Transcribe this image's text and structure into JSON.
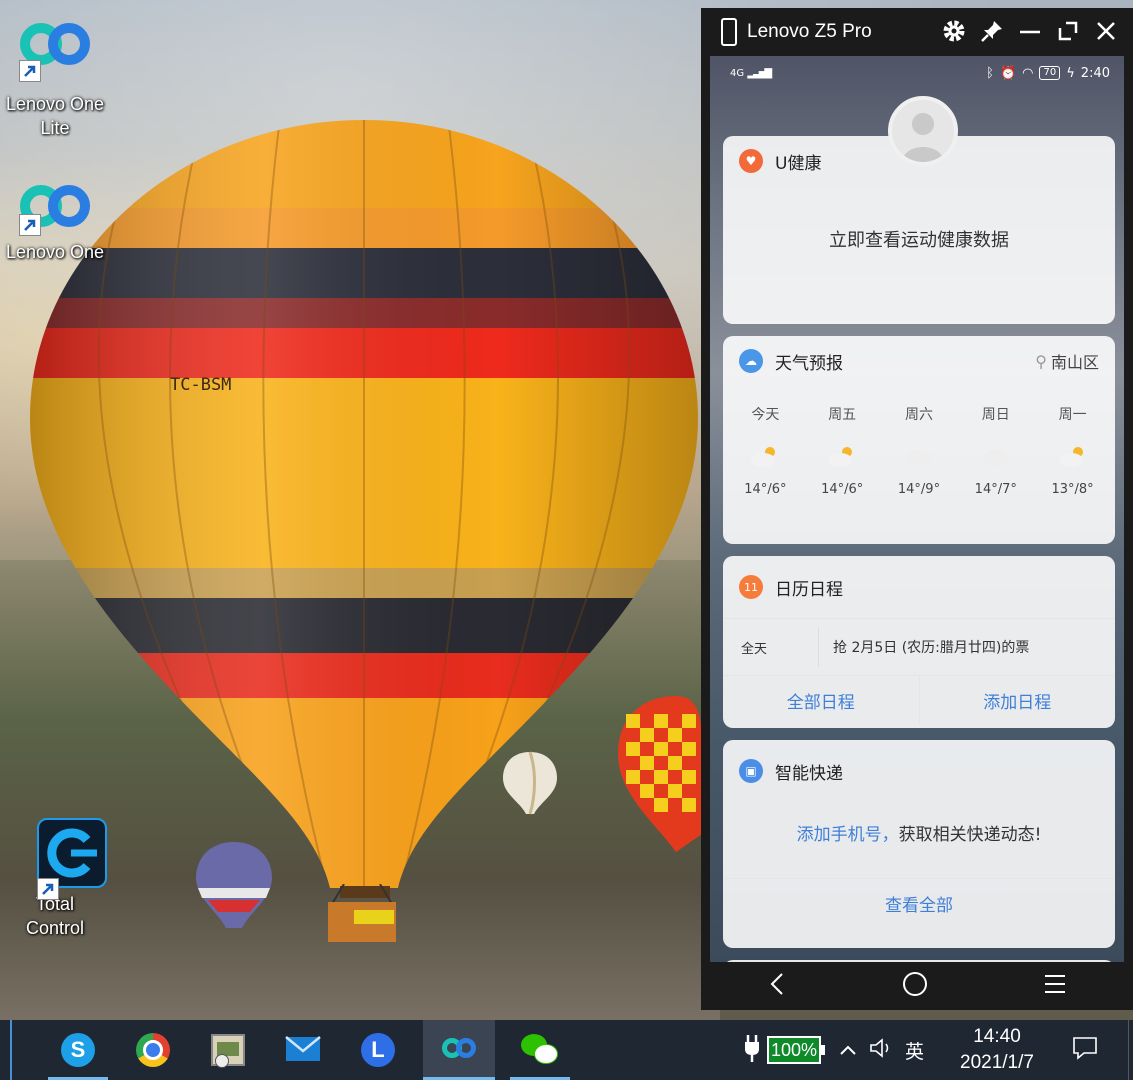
{
  "desktop": {
    "icons": [
      {
        "label": "Lenovo One Lite",
        "icon": "lenovo-one-lite-icon"
      },
      {
        "label": "Lenovo One",
        "icon": "lenovo-one-icon"
      },
      {
        "label": "Total Control",
        "icon": "total-control-icon"
      }
    ],
    "balloon_marking": "TC-BSM"
  },
  "phone_window": {
    "title": "Lenovo Z5 Pro",
    "buttons": [
      "gear-icon",
      "pin-icon",
      "minimize-icon",
      "maximize-icon",
      "close-icon"
    ],
    "status_bar": {
      "signal": "4G",
      "battery": "70",
      "time": "2:40"
    },
    "health_card": {
      "title": "U健康",
      "message": "立即查看运动健康数据"
    },
    "weather_card": {
      "title": "天气预报",
      "location": "南山区",
      "days": [
        {
          "day": "今天",
          "temp": "14°/6°",
          "icon": "sunny-cloud-icon"
        },
        {
          "day": "周五",
          "temp": "14°/6°",
          "icon": "sunny-cloud-icon"
        },
        {
          "day": "周六",
          "temp": "14°/9°",
          "icon": "cloud-icon"
        },
        {
          "day": "周日",
          "temp": "14°/7°",
          "icon": "cloud-icon"
        },
        {
          "day": "周一",
          "temp": "13°/8°",
          "icon": "sunny-cloud-icon"
        }
      ]
    },
    "calendar_card": {
      "badge": "11",
      "title": "日历日程",
      "event_time": "全天",
      "event_text": "抢 2月5日 (农历:腊月廿四)的票",
      "all_link": "全部日程",
      "add_link": "添加日程"
    },
    "delivery_card": {
      "title": "智能快递",
      "message_link": "添加手机号，",
      "message_rest": "获取相关快递动态!",
      "view_all": "查看全部"
    }
  },
  "taskbar": {
    "apps": [
      "skype-icon",
      "chrome-icon",
      "photo-viewer-icon",
      "mail-icon",
      "lenovo-l-icon",
      "lenovo-one-icon",
      "wechat-icon"
    ],
    "battery_percent": "100%",
    "ime": "英",
    "time": "14:40",
    "date": "2021/1/7"
  },
  "colors": {
    "taskbar": "#1f2733",
    "link_blue": "#3f7fd8",
    "active_app_line": "#76b9ed",
    "battery_green": "#0e8a2a"
  }
}
